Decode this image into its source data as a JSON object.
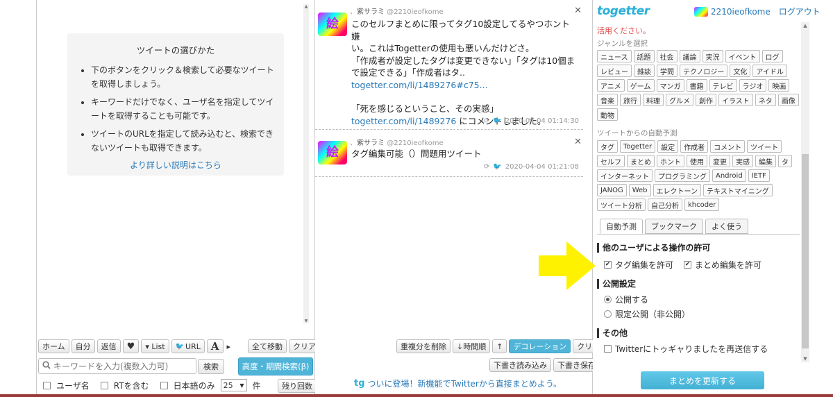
{
  "left": {
    "guide_title": "ツイートの選びかた",
    "guide_items": [
      "下のボタンをクリック＆検索して必要なツイートを取得しましょう。",
      "キーワードだけでなく、ユーザ名を指定してツイートを取得することも可能です。",
      "ツイートのURLを指定して読み込むと、検索できないツイートも取得できます。"
    ],
    "guide_more": "より詳しい説明はこちら",
    "toolbar": {
      "home": "ホーム",
      "self": "自分",
      "reply": "返信",
      "heart": "♥",
      "list": "▾ List",
      "url": "URL",
      "font": "A",
      "more": "▸",
      "move_all": "全て移動",
      "clear": "クリア"
    },
    "search_placeholder": "キーワードを入力(複数入力可)",
    "search_button": "検索",
    "advanced_button": "高度・期間検索(β)",
    "opt_user": "ユーザ名",
    "opt_rt": "RTを含む",
    "opt_ja": "日本語のみ",
    "count_value": "25",
    "count_unit": "件",
    "remaining": "残り回数"
  },
  "middle": {
    "tweets": [
      {
        "name": "紫サラミ",
        "handle": "@2210ieofkome",
        "lines": [
          "このセルフまとめに限ってタグ10設定してるやつホント嫌",
          "い。これはTogetterの使用も悪いんだけどさ。",
          "「作成者が設定したタグは変更できない」「タグは10個ま",
          "で設定できる」「作成者はタ.."
        ],
        "link1": "togetter.com/li/1489276#c75...",
        "line5": "「死を感じるということ、その実感」",
        "link2": "togetter.com/li/1489276",
        "tail": " にコメントしました。",
        "time": "2020-04-04 01:14:30"
      },
      {
        "name": "紫サラミ",
        "handle": "@2210ieofkome",
        "text": "タグ編集可能（）問題用ツイート",
        "time": "2020-04-04 01:21:08"
      }
    ],
    "toolbar": {
      "dedupe": "重複分を削除",
      "sort": "↓時間順",
      "up": "↑",
      "decoration": "デコレーション",
      "clear": "クリア",
      "load_draft": "下書き読み込み",
      "save_draft": "下書き保存"
    },
    "promo": "ついに登場！新機能でTwitterから直接まとめよう。",
    "promo_icon": "tg"
  },
  "right": {
    "logo": "togetter",
    "username": "2210ieofkome",
    "logout": "ログアウト",
    "notice": "活用ください。",
    "genre_heading": "ジャンルを選択",
    "genre_tags": [
      "ニュース",
      "話題",
      "社会",
      "議論",
      "実況",
      "イベント",
      "ログ",
      "レビュー",
      "雑談",
      "学問",
      "テクノロジー",
      "文化",
      "アイドル",
      "アニメ",
      "ゲーム",
      "マンガ",
      "書籍",
      "テレビ",
      "ラジオ",
      "映画",
      "音楽",
      "旅行",
      "料理",
      "グルメ",
      "創作",
      "イラスト",
      "ネタ",
      "画像",
      "動物"
    ],
    "auto_heading": "ツイートからの自動予測",
    "auto_tags": [
      "タグ",
      "Togetter",
      "設定",
      "作成者",
      "コメント",
      "ツイート",
      "セルフ",
      "まとめ",
      "ホント",
      "使用",
      "変更",
      "実感",
      "編集",
      "タ",
      "インターネット",
      "プログラミング",
      "Android",
      "IETF",
      "JANOG",
      "Web",
      "エレクトーン",
      "テキストマイニング",
      "ツイート分析",
      "自己分析",
      "khcoder"
    ],
    "tabs": [
      "自動予測",
      "ブックマーク",
      "よく使う"
    ],
    "perm_heading": "他のユーザによる操作の許可",
    "perm_tag": "タグ編集を許可",
    "perm_matome": "まとめ編集を許可",
    "public_heading": "公開設定",
    "public_on": "公開する",
    "public_limited": "限定公開（非公開）",
    "other_heading": "その他",
    "other_resend": "Twitterにトゥギャりましたを再送信する",
    "update_button": "まとめを更新する"
  },
  "colors": {
    "accent": "#42b0d4",
    "arrow": "#fff200",
    "link": "#2a7ab8"
  }
}
